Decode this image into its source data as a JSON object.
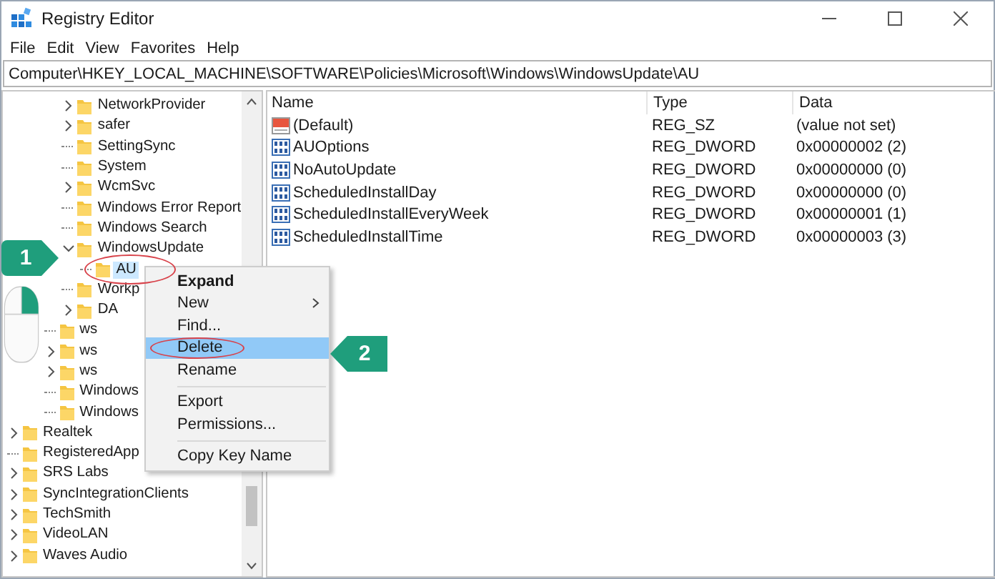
{
  "window": {
    "title": "Registry Editor"
  },
  "menu_bar": [
    "File",
    "Edit",
    "View",
    "Favorites",
    "Help"
  ],
  "address": "Computer\\HKEY_LOCAL_MACHINE\\SOFTWARE\\Policies\\Microsoft\\Windows\\WindowsUpdate\\AU",
  "tree": {
    "items": [
      {
        "children": [
          {
            "children": [
              {
                "children": [
                  {
                    "label": "NetworkProvider",
                    "expanded": false,
                    "selected": false
                  },
                  {
                    "label": "safer",
                    "expanded": false,
                    "selected": false
                  },
                  {
                    "label": "SettingSync",
                    "selected": false
                  },
                  {
                    "label": "System",
                    "selected": false
                  },
                  {
                    "label": "WcmSvc",
                    "expanded": false,
                    "selected": false
                  },
                  {
                    "label": "Windows Error Report",
                    "selected": false
                  },
                  {
                    "label": "Windows Search",
                    "selected": false
                  },
                  {
                    "label": "WindowsUpdate",
                    "expanded": true,
                    "selected": false,
                    "children": [
                      {
                        "label": "AU",
                        "selected": true
                      }
                    ]
                  },
                  {
                    "label": "Workp",
                    "selected": false
                  },
                  {
                    "label": "DA",
                    "expanded": false,
                    "selected": false
                  }
                ]
              },
              {
                "label": "ws",
                "selected": false
              },
              {
                "label": "ws",
                "expanded": false,
                "selected": false
              },
              {
                "label": "ws",
                "expanded": false,
                "selected": false
              },
              {
                "label": "Windows",
                "selected": false
              },
              {
                "label": "Windows",
                "selected": false
              }
            ]
          }
        ]
      },
      {
        "label": "Realtek",
        "expanded": false,
        "selected": false
      },
      {
        "label": "RegisteredApp",
        "selected": false
      },
      {
        "label": "SRS Labs",
        "expanded": false,
        "selected": false
      },
      {
        "label": "SyncIntegrationClients",
        "expanded": false,
        "selected": false
      },
      {
        "label": "TechSmith",
        "expanded": false,
        "selected": false
      },
      {
        "label": "VideoLAN",
        "expanded": false,
        "selected": false
      },
      {
        "label": "Waves Audio",
        "expanded": false,
        "selected": false
      }
    ]
  },
  "values": {
    "columns": [
      "Name",
      "Type",
      "Data"
    ],
    "rows": [
      {
        "kind": "string",
        "name": "(Default)",
        "type": "REG_SZ",
        "data": "(value not set)"
      },
      {
        "kind": "binary",
        "name": "AUOptions",
        "type": "REG_DWORD",
        "data": "0x00000002 (2)"
      },
      {
        "kind": "binary",
        "name": "NoAutoUpdate",
        "type": "REG_DWORD",
        "data": "0x00000000 (0)"
      },
      {
        "kind": "binary",
        "name": "ScheduledInstallDay",
        "type": "REG_DWORD",
        "data": "0x00000000 (0)"
      },
      {
        "kind": "binary",
        "name": "ScheduledInstallEveryWeek",
        "type": "REG_DWORD",
        "data": "0x00000001 (1)"
      },
      {
        "kind": "binary",
        "name": "ScheduledInstallTime",
        "type": "REG_DWORD",
        "data": "0x00000003 (3)"
      }
    ]
  },
  "context_menu": {
    "items": [
      {
        "kind": "item",
        "label": "Expand",
        "bold": true,
        "submenu": false,
        "selected": false
      },
      {
        "kind": "item",
        "label": "New",
        "bold": false,
        "submenu": true,
        "selected": false
      },
      {
        "kind": "item",
        "label": "Find...",
        "bold": false,
        "submenu": false,
        "selected": false
      },
      {
        "kind": "item",
        "label": "Delete",
        "bold": false,
        "submenu": false,
        "selected": true
      },
      {
        "kind": "item",
        "label": "Rename",
        "bold": false,
        "submenu": false,
        "selected": false
      },
      {
        "kind": "separator"
      },
      {
        "kind": "item",
        "label": "Export",
        "bold": false,
        "submenu": false,
        "selected": false
      },
      {
        "kind": "item",
        "label": "Permissions...",
        "bold": false,
        "submenu": false,
        "selected": false
      },
      {
        "kind": "separator"
      },
      {
        "kind": "item",
        "label": "Copy Key Name",
        "bold": false,
        "submenu": false,
        "selected": false
      }
    ]
  },
  "callouts": [
    {
      "label": "1"
    },
    {
      "label": "2"
    }
  ]
}
